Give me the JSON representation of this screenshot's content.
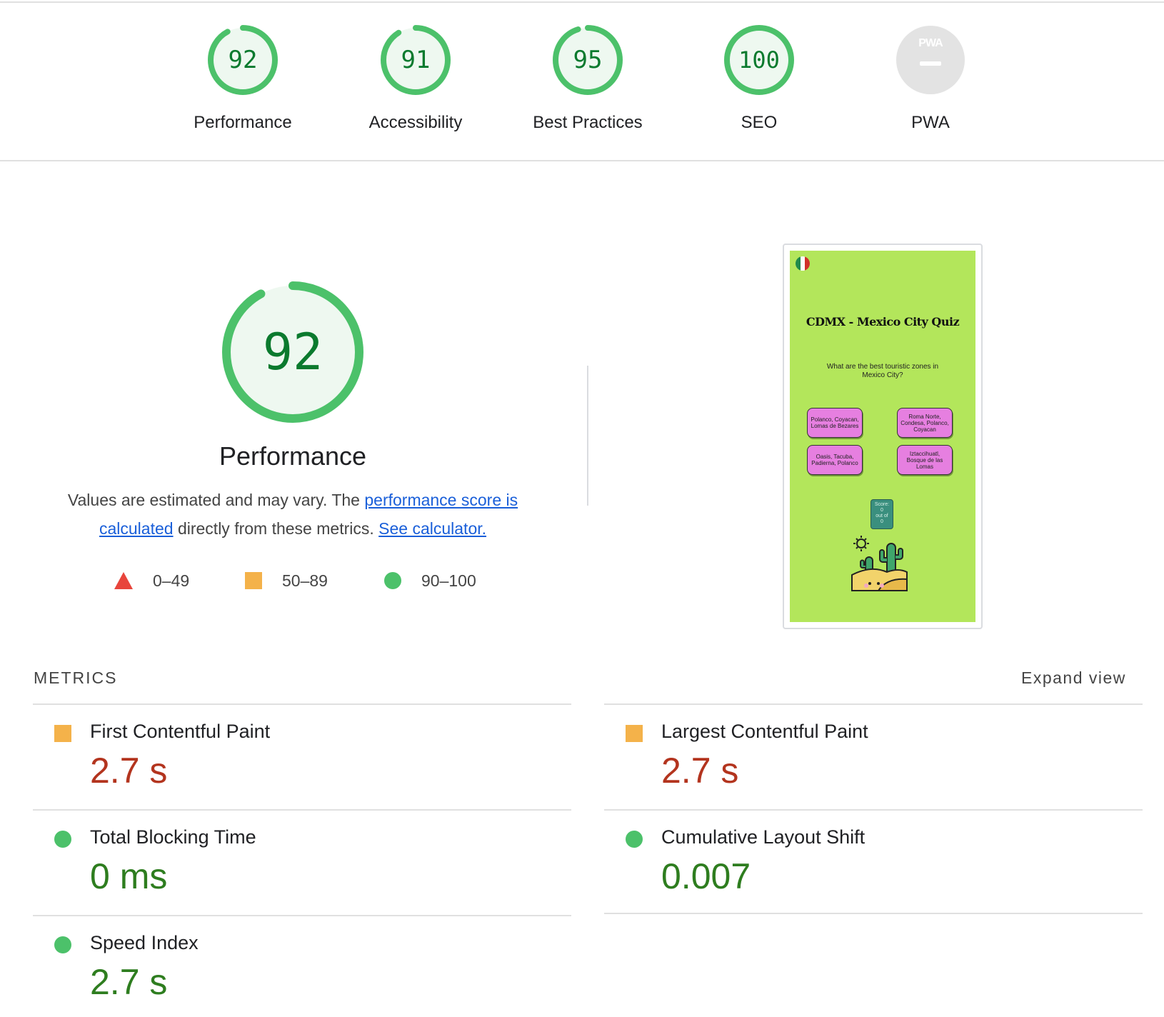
{
  "categories": [
    {
      "score": "92",
      "label": "Performance",
      "fraction": 0.92
    },
    {
      "score": "91",
      "label": "Accessibility",
      "fraction": 0.91
    },
    {
      "score": "95",
      "label": "Best Practices",
      "fraction": 0.95
    },
    {
      "score": "100",
      "label": "SEO",
      "fraction": 1.0
    },
    {
      "score": "",
      "label": "PWA",
      "fraction": 0,
      "icon_text": "PWA"
    }
  ],
  "performance": {
    "score": "92",
    "fraction": 0.92,
    "title": "Performance",
    "desc_prefix": "Values are estimated and may vary. The ",
    "desc_link": "performance score is calculated",
    "desc_middle": " directly from these metrics. ",
    "desc_link2": "See calculator."
  },
  "legend": [
    {
      "shape": "triangle",
      "range": "0–49",
      "color": "#e8453c"
    },
    {
      "shape": "square",
      "range": "50–89",
      "color": "#f4b24a"
    },
    {
      "shape": "circle",
      "range": "90–100",
      "color": "#4cc16a"
    }
  ],
  "screenshot": {
    "title": "CDMX - Mexico City Quiz",
    "question": "What are the best touristic zones in Mexico City?",
    "options": [
      "Polanco, Coyacan, Lomas de Bezares",
      "Roma Norte, Condesa, Polanco, Coyacan",
      "Oasis, Tacuba, Padierna, Polanco",
      "Iztaccihuatl, Bosque de las Lomas"
    ],
    "score_label": "Score:",
    "score_value": "0",
    "score_out_of": "out of",
    "score_total": "0"
  },
  "metrics": {
    "header": "METRICS",
    "expand": "Expand view",
    "items": [
      {
        "label": "First Contentful Paint",
        "value": "2.7 s",
        "rating": "average"
      },
      {
        "label": "Largest Contentful Paint",
        "value": "2.7 s",
        "rating": "average"
      },
      {
        "label": "Total Blocking Time",
        "value": "0 ms",
        "rating": "pass"
      },
      {
        "label": "Cumulative Layout Shift",
        "value": "0.007",
        "rating": "pass"
      },
      {
        "label": "Speed Index",
        "value": "2.7 s",
        "rating": "pass"
      }
    ]
  },
  "colors": {
    "pass": "#4cc16a",
    "average": "#f4b24a",
    "pass_text": "#2e7d1f",
    "average_text": "#b3341e",
    "gauge_fill": "#eef8f0"
  }
}
